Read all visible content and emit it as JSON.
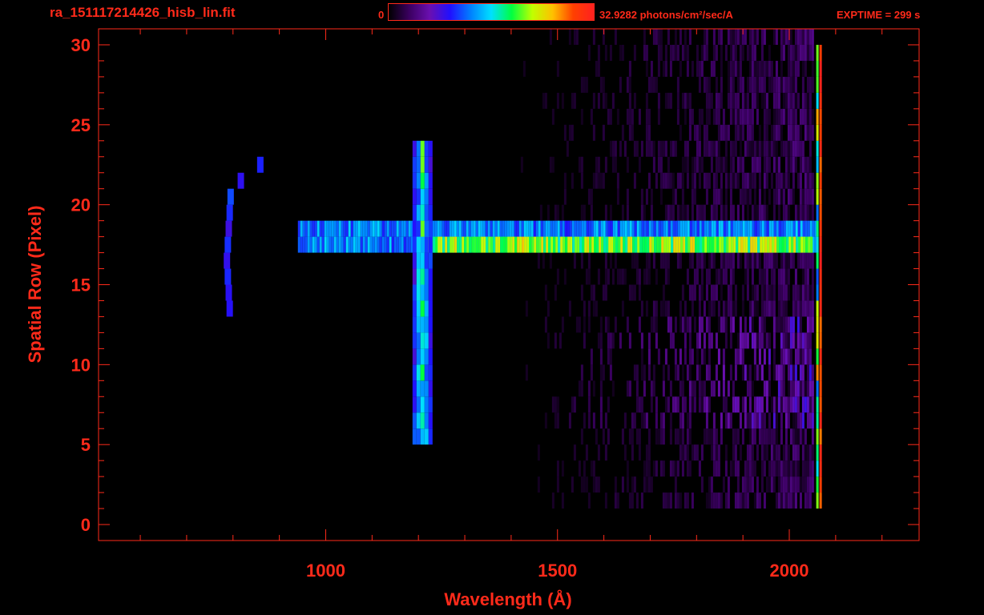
{
  "header": {
    "filename": "ra_151117214426_hisb_lin.fit",
    "colorbar_min": "0",
    "colorbar_max": "32.9282 photons/cm²/sec/A",
    "exptime": "EXPTIME = 299 s"
  },
  "colors": {
    "axes": "#ff2a1a",
    "background": "#000000",
    "colormap": [
      "#000000",
      "#3a0060",
      "#6a0fb0",
      "#2010ff",
      "#0080ff",
      "#00e0ff",
      "#00ff40",
      "#c0ff00",
      "#ffc000",
      "#ff4000",
      "#ff2020"
    ]
  },
  "chart_data": {
    "type": "heatmap",
    "title": "ra_151117214426_hisb_lin.fit",
    "xlabel": "Wavelength (Å)",
    "ylabel": "Spatial Row (Pixel)",
    "xlim": [
      510,
      2280
    ],
    "ylim": [
      -1,
      31
    ],
    "x_ticks": [
      1000,
      1500,
      2000
    ],
    "y_ticks": [
      0,
      5,
      10,
      15,
      20,
      25,
      30
    ],
    "colorbar_range": [
      0,
      32.9282
    ],
    "colorbar_unit": "photons/cm²/sec/A",
    "features": [
      {
        "name": "continuum band",
        "x_range": [
          940,
          2060
        ],
        "y_range": [
          17,
          19
        ],
        "relative_intensity": 0.55
      },
      {
        "name": "bright stripe",
        "x_range": [
          1200,
          2050
        ],
        "y_range": [
          17,
          18
        ],
        "relative_intensity": 0.75
      },
      {
        "name": "vertical line",
        "x_center": 1208,
        "y_range": [
          5,
          24
        ],
        "relative_intensity": 0.6
      },
      {
        "name": "arc",
        "x_range": [
          780,
          920
        ],
        "y_range": [
          13,
          23
        ],
        "relative_intensity": 0.3
      },
      {
        "name": "detector edge",
        "x_center": 2065,
        "y_range": [
          1,
          30
        ],
        "relative_intensity": 1.0
      }
    ]
  }
}
